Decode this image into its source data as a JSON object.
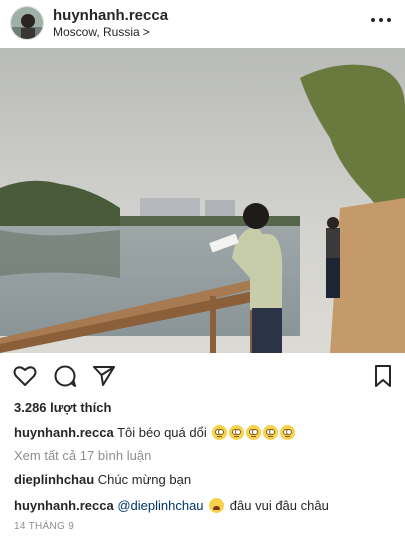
{
  "post": {
    "username": "huynhanh.recca",
    "location": "Moscow, Russia",
    "location_chevron": ">"
  },
  "likes_text": "3.286 lượt thích",
  "caption": {
    "username": "huynhanh.recca",
    "text": "Tôi béo quá dổi",
    "emoji": [
      "rolling-eyes-emoji",
      "rolling-eyes-emoji",
      "rolling-eyes-emoji",
      "rolling-eyes-emoji",
      "rolling-eyes-emoji"
    ]
  },
  "view_comments_text": "Xem tất cả 17 bình luận",
  "comments": [
    {
      "username": "dieplinhchau",
      "text": "Chúc mừng bạn"
    },
    {
      "username": "huynhanh.recca",
      "mention": "@dieplinhchau",
      "emoji": "tired-face-emoji",
      "text": "đâu vui đâu châu"
    }
  ],
  "date_text": "14 THÁNG 9",
  "icons": {
    "like": "heart-icon",
    "comment": "comment-icon",
    "share": "paper-plane-icon",
    "save": "bookmark-icon",
    "more": "more-icon"
  },
  "colors": {
    "text": "#262626",
    "secondary": "#8e8e8e",
    "mention": "#00376b"
  }
}
